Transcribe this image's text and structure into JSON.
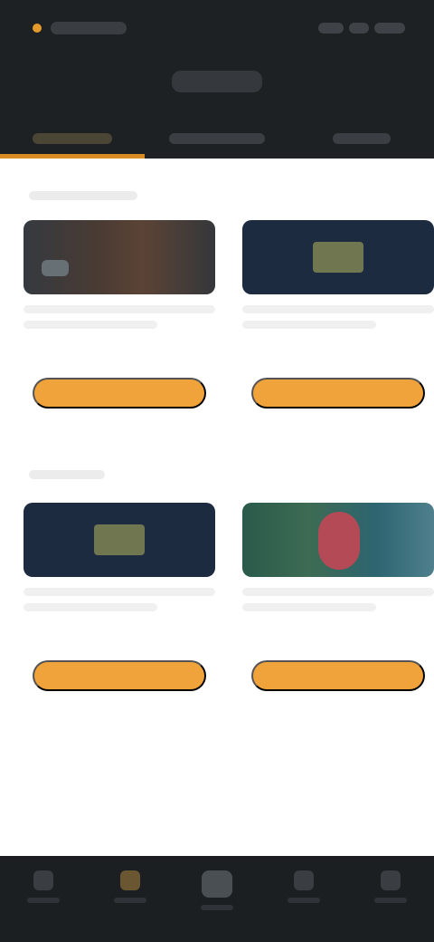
{
  "colors": {
    "header_bg": "#1e2124",
    "accent": "#d88d24",
    "button": "#f1a33b",
    "page_bg": "#ffffff"
  },
  "status_bar": {
    "icons": [
      "signal-icon",
      "wifi-icon",
      "battery-icon"
    ]
  },
  "tabs": [
    {
      "active": true
    },
    {
      "active": false
    },
    {
      "active": false
    }
  ],
  "sections": [
    {
      "cards": [
        {
          "image": "video-thumbnail",
          "button_label": ""
        },
        {
          "image": "logo-thumbnail",
          "button_label": ""
        }
      ]
    },
    {
      "cards": [
        {
          "image": "logo-thumbnail",
          "button_label": ""
        },
        {
          "image": "person-thumbnail",
          "button_label": ""
        }
      ]
    }
  ],
  "bottom_nav": [
    {
      "icon": "home-icon",
      "active": false
    },
    {
      "icon": "explore-icon",
      "active": true
    },
    {
      "icon": "center-action-icon",
      "active": false
    },
    {
      "icon": "inbox-icon",
      "active": false
    },
    {
      "icon": "profile-icon",
      "active": false
    }
  ]
}
